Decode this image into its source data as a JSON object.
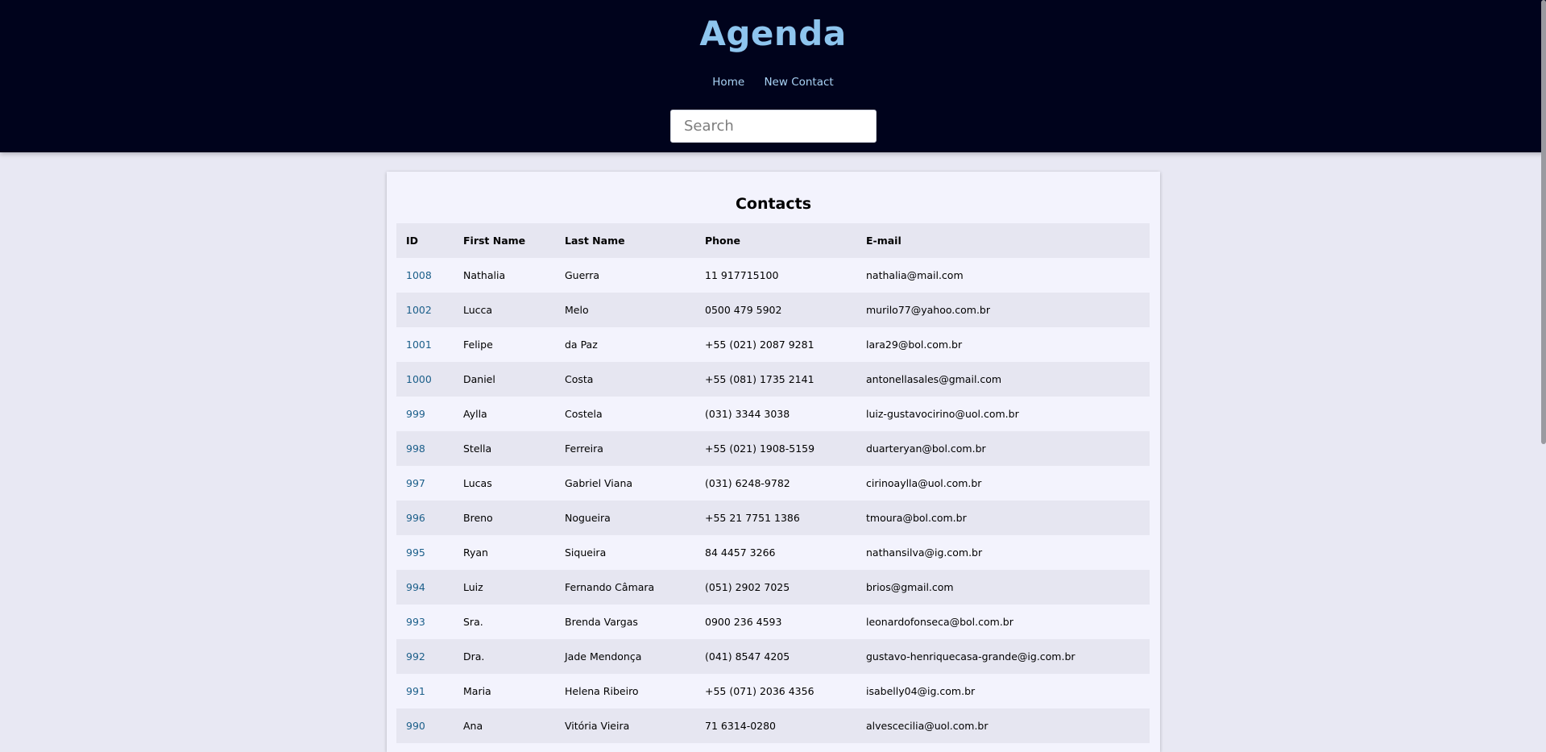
{
  "header": {
    "title": "Agenda",
    "nav": {
      "home": "Home",
      "new_contact": "New Contact"
    },
    "search": {
      "placeholder": "Search",
      "value": ""
    }
  },
  "main": {
    "title": "Contacts",
    "columns": [
      "ID",
      "First Name",
      "Last Name",
      "Phone",
      "E-mail"
    ],
    "rows": [
      [
        "1008",
        "Nathalia",
        "Guerra",
        "11 917715100",
        "nathalia@mail.com"
      ],
      [
        "1002",
        "Lucca",
        "Melo",
        "0500 479 5902",
        "murilo77@yahoo.com.br"
      ],
      [
        "1001",
        "Felipe",
        "da Paz",
        "+55 (021) 2087 9281",
        "lara29@bol.com.br"
      ],
      [
        "1000",
        "Daniel",
        "Costa",
        "+55 (081) 1735 2141",
        "antonellasales@gmail.com"
      ],
      [
        "999",
        "Aylla",
        "Costela",
        "(031) 3344 3038",
        "luiz-gustavocirino@uol.com.br"
      ],
      [
        "998",
        "Stella",
        "Ferreira",
        "+55 (021) 1908-5159",
        "duarteryan@bol.com.br"
      ],
      [
        "997",
        "Lucas",
        "Gabriel Viana",
        "(031) 6248-9782",
        "cirinoaylla@uol.com.br"
      ],
      [
        "996",
        "Breno",
        "Nogueira",
        "+55 21 7751 1386",
        "tmoura@bol.com.br"
      ],
      [
        "995",
        "Ryan",
        "Siqueira",
        "84 4457 3266",
        "nathansilva@ig.com.br"
      ],
      [
        "994",
        "Luiz",
        "Fernando Câmara",
        "(051) 2902 7025",
        "brios@gmail.com"
      ],
      [
        "993",
        "Sra.",
        "Brenda Vargas",
        "0900 236 4593",
        "leonardofonseca@bol.com.br"
      ],
      [
        "992",
        "Dra.",
        "Jade Mendonça",
        "(041) 8547 4205",
        "gustavo-henriquecasa-grande@ig.com.br"
      ],
      [
        "991",
        "Maria",
        "Helena Ribeiro",
        "+55 (071) 2036 4356",
        "isabelly04@ig.com.br"
      ],
      [
        "990",
        "Ana",
        "Vitória Vieira",
        "71 6314-0280",
        "alvescecilia@uol.com.br"
      ]
    ]
  },
  "colors": {
    "header_bg": "#00031c",
    "title": "#8ec5ee",
    "nav_link": "#a9d3f5",
    "id_link": "#1c5f8a",
    "page_bg": "#e8e8f3"
  }
}
